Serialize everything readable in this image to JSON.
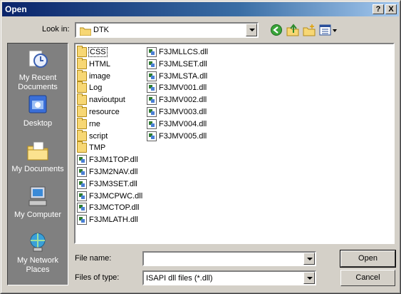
{
  "window": {
    "title": "Open"
  },
  "titlebar": {
    "help": "?",
    "close": "X"
  },
  "lookin": {
    "label": "Look in:",
    "value": "DTK"
  },
  "places": [
    {
      "label_1": "My Recent",
      "label_2": "Documents",
      "icon": "recent-documents-icon"
    },
    {
      "label_1": "Desktop",
      "label_2": "",
      "icon": "desktop-icon"
    },
    {
      "label_1": "My Documents",
      "label_2": "",
      "icon": "my-documents-icon"
    },
    {
      "label_1": "My Computer",
      "label_2": "",
      "icon": "my-computer-icon"
    },
    {
      "label_1": "My Network",
      "label_2": "Places",
      "icon": "network-places-icon"
    }
  ],
  "files": {
    "col1": [
      {
        "name": "CSS",
        "type": "folder"
      },
      {
        "name": "HTML",
        "type": "folder"
      },
      {
        "name": "image",
        "type": "folder"
      },
      {
        "name": "Log",
        "type": "folder"
      },
      {
        "name": "navioutput",
        "type": "folder"
      },
      {
        "name": "resource",
        "type": "folder"
      },
      {
        "name": "rne",
        "type": "folder"
      },
      {
        "name": "script",
        "type": "folder"
      },
      {
        "name": "TMP",
        "type": "folder"
      },
      {
        "name": "F3JM1TOP.dll",
        "type": "dll"
      },
      {
        "name": "F3JM2NAV.dll",
        "type": "dll"
      },
      {
        "name": "F3JM3SET.dll",
        "type": "dll"
      },
      {
        "name": "F3JMCPWC.dll",
        "type": "dll"
      },
      {
        "name": "F3JMCTOP.dll",
        "type": "dll"
      },
      {
        "name": "F3JMLATH.dll",
        "type": "dll"
      }
    ],
    "col2": [
      {
        "name": "F3JMLLCS.dll",
        "type": "dll"
      },
      {
        "name": "F3JMLSET.dll",
        "type": "dll"
      },
      {
        "name": "F3JMLSTA.dll",
        "type": "dll"
      },
      {
        "name": "F3JMV001.dll",
        "type": "dll"
      },
      {
        "name": "F3JMV002.dll",
        "type": "dll"
      },
      {
        "name": "F3JMV003.dll",
        "type": "dll"
      },
      {
        "name": "F3JMV004.dll",
        "type": "dll"
      },
      {
        "name": "F3JMV005.dll",
        "type": "dll"
      }
    ]
  },
  "filename": {
    "label": "File name:",
    "value": ""
  },
  "filetype": {
    "label": "Files of type:",
    "value": "ISAPI dll files (*.dll)"
  },
  "buttons": {
    "open": "Open",
    "cancel": "Cancel"
  },
  "colors": {
    "titlebar_start": "#0a246a",
    "titlebar_end": "#a6caf0",
    "dialog_bg": "#d4d0c8",
    "places_bg": "#808080"
  }
}
